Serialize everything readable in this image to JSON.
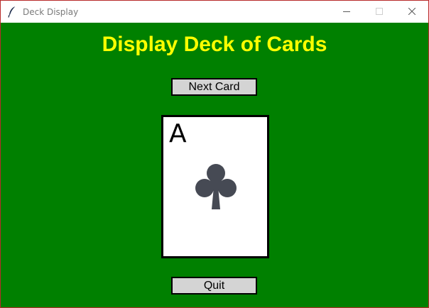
{
  "window": {
    "title": "Deck Display",
    "app_icon": "feather-icon",
    "controls": [
      "minimize-icon",
      "maximize-icon",
      "close-icon"
    ]
  },
  "main": {
    "heading": "Display Deck of Cards",
    "next_button_label": "Next Card",
    "quit_button_label": "Quit",
    "card": {
      "rank": "A",
      "suit": "clubs",
      "suit_icon": "club-suit-icon"
    }
  },
  "colors": {
    "background": "#008000",
    "heading": "#ffff00",
    "button_face": "#d4d4d4",
    "suit": "#464a54",
    "window_border": "#b82a2a"
  }
}
